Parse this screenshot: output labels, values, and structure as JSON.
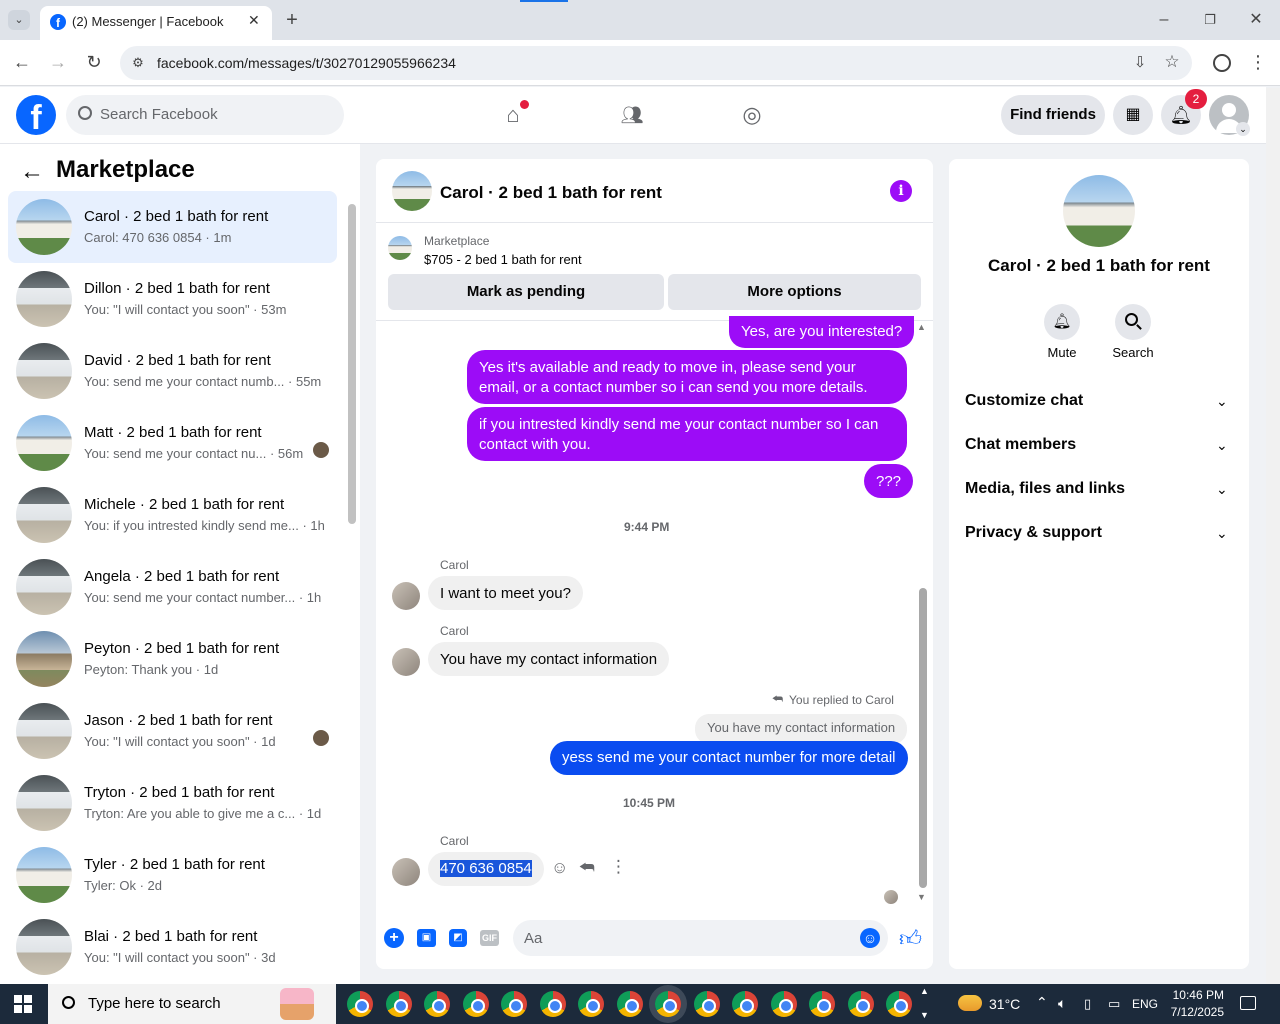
{
  "browser": {
    "tab_title": "(2) Messenger | Facebook",
    "url": "facebook.com/messages/t/30270129055966234"
  },
  "fb_header": {
    "search_placeholder": "Search Facebook",
    "find_friends": "Find friends",
    "notif_count": "2"
  },
  "sidebar": {
    "title": "Marketplace",
    "conversations": [
      {
        "name": "Carol · 2 bed 1 bath for rent",
        "preview": "Carol: 470 636 0854 · 1m"
      },
      {
        "name": "Dillon · 2 bed 1 bath for rent",
        "preview": "You: \"I will contact you soon\" · 53m"
      },
      {
        "name": "David · 2 bed 1 bath for rent",
        "preview": "You: send me your contact numb... · 55m"
      },
      {
        "name": "Matt · 2 bed 1 bath for rent",
        "preview": "You: send me your contact nu...  · 56m"
      },
      {
        "name": "Michele · 2 bed 1 bath for rent",
        "preview": "You: if you intrested kindly send me... · 1h"
      },
      {
        "name": "Angela · 2 bed 1 bath for rent",
        "preview": "You: send me your contact number... · 1h"
      },
      {
        "name": "Peyton · 2 bed 1 bath for rent",
        "preview": "Peyton: Thank you · 1d"
      },
      {
        "name": "Jason · 2 bed 1 bath for rent",
        "preview": "You: \"I will contact you soon\" · 1d"
      },
      {
        "name": "Tryton · 2 bed 1 bath for rent",
        "preview": "Tryton: Are you able to give me a c... · 1d"
      },
      {
        "name": "Tyler · 2 bed 1 bath for rent",
        "preview": "Tyler: Ok · 2d"
      },
      {
        "name": "Blai · 2 bed 1 bath for rent",
        "preview": "You: \"I will contact you soon\" · 3d"
      }
    ]
  },
  "chat": {
    "title": "Carol · 2 bed 1 bath for rent",
    "listing_label": "Marketplace",
    "listing_title": "$705 - 2 bed 1 bath for rent",
    "mark_pending": "Mark as pending",
    "more_options": "More options",
    "msg_out_1": "Yes, are you interested?",
    "msg_out_2": "Yes it's available and ready to move in, please send your email, or a contact number so i can send you more details.",
    "msg_out_3": "if you intrested  kindly send me your contact number so I can contact with you.",
    "msg_out_4": "???",
    "time_1": "9:44 PM",
    "sender_1": "Carol",
    "msg_in_1": "I want to  meet you?",
    "sender_2": "Carol",
    "msg_in_2": "You have my contact information",
    "replied_label": "You replied to Carol",
    "quoted": "You have my contact information",
    "msg_out_5": "yess send me your contact number for more detail",
    "time_2": "10:45 PM",
    "sender_3": "Carol",
    "msg_in_3": "470 636 0854",
    "composer_placeholder": "Aa"
  },
  "right_pane": {
    "title": "Carol · 2 bed 1 bath for rent",
    "mute": "Mute",
    "search": "Search",
    "sections": [
      "Customize chat",
      "Chat members",
      "Media, files and links",
      "Privacy & support"
    ]
  },
  "taskbar": {
    "search_placeholder": "Type here to search",
    "temperature": "31°C",
    "lang": "ENG",
    "time": "10:46 PM",
    "date": "7/12/2025"
  },
  "colors": {
    "accent_purple": "#9c0cf7",
    "fb_blue": "#0866ff",
    "blue_bubble": "#0a4cf0"
  }
}
